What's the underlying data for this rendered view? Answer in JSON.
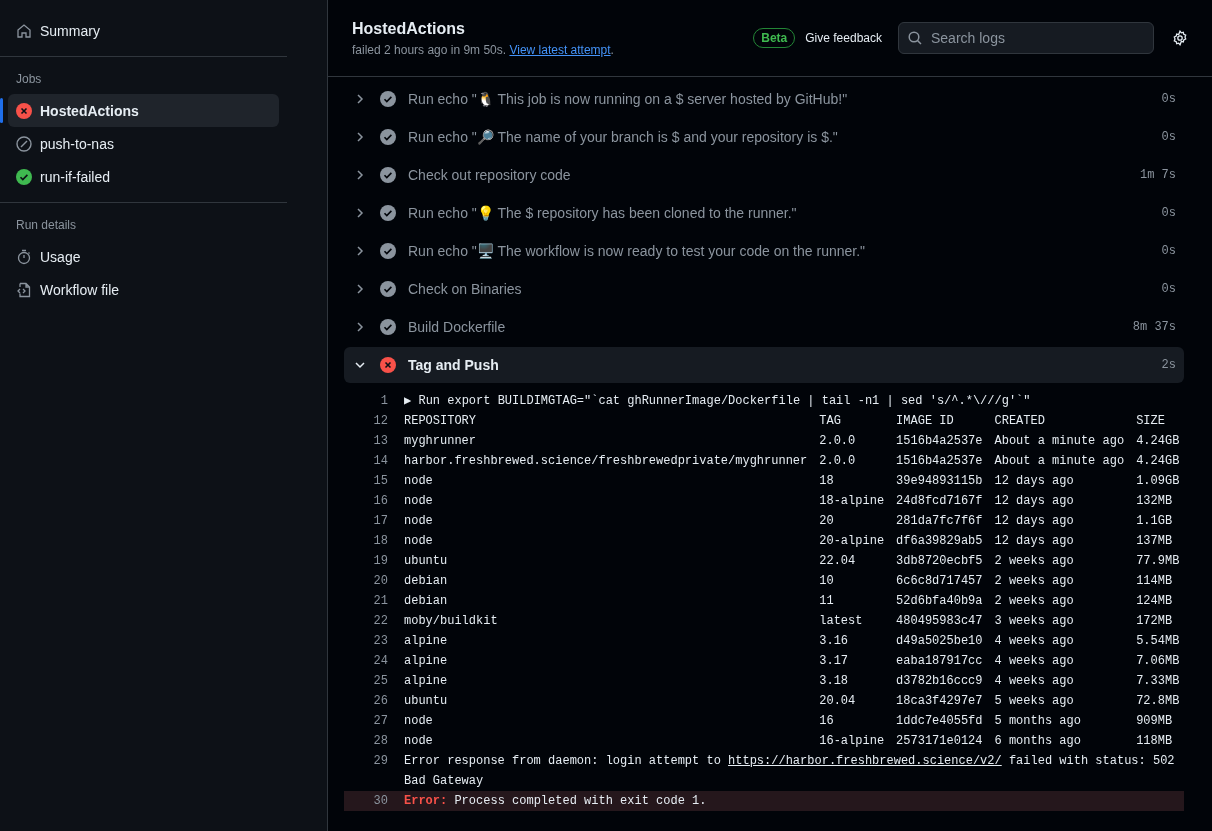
{
  "sidebar": {
    "summary": "Summary",
    "jobs_heading": "Jobs",
    "jobs": [
      {
        "name": "HostedActions",
        "kind": "failed",
        "selected": true
      },
      {
        "name": "push-to-nas",
        "kind": "skipped",
        "selected": false
      },
      {
        "name": "run-if-failed",
        "kind": "success",
        "selected": false
      }
    ],
    "details_heading": "Run details",
    "details": [
      {
        "label": "Usage",
        "kind": "usage"
      },
      {
        "label": "Workflow file",
        "kind": "file"
      }
    ]
  },
  "header": {
    "title": "HostedActions",
    "subtitle": "failed 2 hours ago in 9m 50s. ",
    "link": "View latest attempt",
    "after_link": ".",
    "badge": "Beta",
    "feedback": "Give feedback",
    "search": {
      "placeholder": "Search logs"
    }
  },
  "steps": [
    {
      "name": "Run echo \"🐧 This job is now running on a $ server hosted by GitHub!\"",
      "duration": "0s",
      "kind": "success",
      "expanded": false
    },
    {
      "name": "Run echo \"🔎 The name of your branch is $ and your repository is $.\"",
      "duration": "0s",
      "kind": "success",
      "expanded": false
    },
    {
      "name": "Check out repository code",
      "duration": "1m 7s",
      "kind": "success",
      "expanded": false
    },
    {
      "name": "Run echo \"💡 The $ repository has been cloned to the runner.\"",
      "duration": "0s",
      "kind": "success",
      "expanded": false
    },
    {
      "name": "Run echo \"🖥️ The workflow is now ready to test your code on the runner.\"",
      "duration": "0s",
      "kind": "success",
      "expanded": false
    },
    {
      "name": "Check on Binaries",
      "duration": "0s",
      "kind": "success",
      "expanded": false
    },
    {
      "name": "Build Dockerfile",
      "duration": "8m 37s",
      "kind": "success",
      "expanded": false
    },
    {
      "name": "Tag and Push",
      "duration": "2s",
      "kind": "failed",
      "expanded": true
    }
  ],
  "log": [
    {
      "n": "1",
      "kind": "command",
      "marker": "▶",
      "text": "Run export BUILDIMGTAG=\"`cat ghRunnerImage/Dockerfile | tail -n1 | sed 's/^.*\\///g'`\""
    },
    {
      "n": "12",
      "kind": "table",
      "cells": [
        "REPOSITORY",
        "TAG",
        "IMAGE ID",
        "CREATED",
        "SIZE"
      ]
    },
    {
      "n": "13",
      "kind": "table",
      "cells": [
        "myghrunner",
        "2.0.0",
        "1516b4a2537e",
        "About a minute ago",
        "4.24GB"
      ]
    },
    {
      "n": "14",
      "kind": "table",
      "cells": [
        "harbor.freshbrewed.science/freshbrewedprivate/myghrunner",
        "2.0.0",
        "1516b4a2537e",
        "About a minute ago",
        "4.24GB"
      ]
    },
    {
      "n": "15",
      "kind": "table",
      "cells": [
        "node",
        "18",
        "39e94893115b",
        "12 days ago",
        "1.09GB"
      ]
    },
    {
      "n": "16",
      "kind": "table",
      "cells": [
        "node",
        "18-alpine",
        "24d8fcd7167f",
        "12 days ago",
        "132MB"
      ]
    },
    {
      "n": "17",
      "kind": "table",
      "cells": [
        "node",
        "20",
        "281da7fc7f6f",
        "12 days ago",
        "1.1GB"
      ]
    },
    {
      "n": "18",
      "kind": "table",
      "cells": [
        "node",
        "20-alpine",
        "df6a39829ab5",
        "12 days ago",
        "137MB"
      ]
    },
    {
      "n": "19",
      "kind": "table",
      "cells": [
        "ubuntu",
        "22.04",
        "3db8720ecbf5",
        "2 weeks ago",
        "77.9MB"
      ]
    },
    {
      "n": "20",
      "kind": "table",
      "cells": [
        "debian",
        "10",
        "6c6c8d717457",
        "2 weeks ago",
        "114MB"
      ]
    },
    {
      "n": "21",
      "kind": "table",
      "cells": [
        "debian",
        "11",
        "52d6bfa40b9a",
        "2 weeks ago",
        "124MB"
      ]
    },
    {
      "n": "22",
      "kind": "table",
      "cells": [
        "moby/buildkit",
        "latest",
        "480495983c47",
        "3 weeks ago",
        "172MB"
      ]
    },
    {
      "n": "23",
      "kind": "table",
      "cells": [
        "alpine",
        "3.16",
        "d49a5025be10",
        "4 weeks ago",
        "5.54MB"
      ]
    },
    {
      "n": "24",
      "kind": "table",
      "cells": [
        "alpine",
        "3.17",
        "eaba187917cc",
        "4 weeks ago",
        "7.06MB"
      ]
    },
    {
      "n": "25",
      "kind": "table",
      "cells": [
        "alpine",
        "3.18",
        "d3782b16ccc9",
        "4 weeks ago",
        "7.33MB"
      ]
    },
    {
      "n": "26",
      "kind": "table",
      "cells": [
        "ubuntu",
        "20.04",
        "18ca3f4297e7",
        "5 weeks ago",
        "72.8MB"
      ]
    },
    {
      "n": "27",
      "kind": "table",
      "cells": [
        "node",
        "16",
        "1ddc7e4055fd",
        "5 months ago",
        "909MB"
      ]
    },
    {
      "n": "28",
      "kind": "table",
      "cells": [
        "node",
        "16-alpine",
        "2573171e0124",
        "6 months ago",
        "118MB"
      ]
    },
    {
      "n": "29",
      "kind": "text",
      "text": "Error response from daemon: login attempt to ",
      "link": "https://harbor.freshbrewed.science/v2/",
      "after": " failed with status: 502 Bad Gateway"
    },
    {
      "n": "30",
      "kind": "error",
      "label": "Error:",
      "text": " Process completed with exit code 1."
    }
  ]
}
